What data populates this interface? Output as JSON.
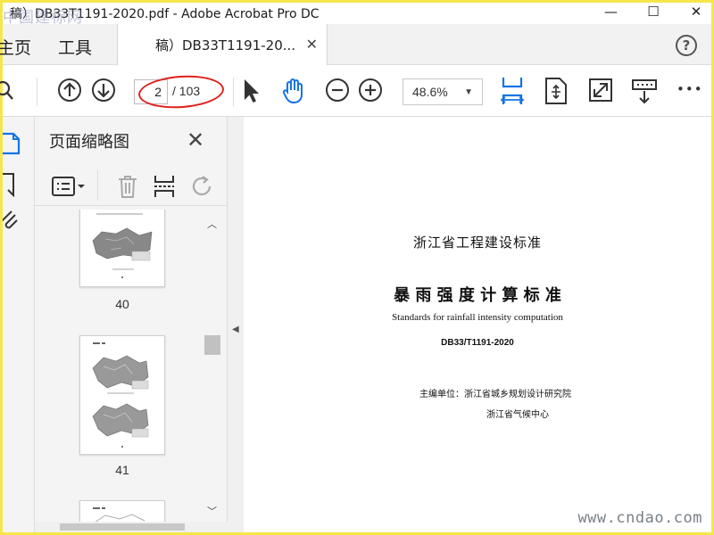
{
  "window": {
    "title": "稿）DB33T1191-2020.pdf - Adobe Acrobat Pro DC",
    "watermark": "中国建标网",
    "controls": [
      "—",
      "☐",
      "✕"
    ]
  },
  "tabs": {
    "home": "主页",
    "tools": "工具",
    "document": "稿）DB33T1191-20...",
    "document_close": "✕",
    "help": "?"
  },
  "toolbar": {
    "page_current": "2",
    "page_total": "/ 103",
    "zoom": "48.6%",
    "zoom_caret": "▼",
    "more": "•••"
  },
  "sidebar": {
    "title": "页面缩略图",
    "close": "✕",
    "thumbnails": [
      {
        "label": "40"
      },
      {
        "label": "41"
      }
    ]
  },
  "document": {
    "org": "浙江省工程建设标准",
    "title_cn": "暴 雨 强 度 计 算 标 准",
    "title_en": "Standards for rainfall intensity computation",
    "code": "DB33/T1191-2020",
    "editor_line1": "主编单位：浙江省城乡规划设计研究院",
    "editor_line2": "浙江省气候中心"
  },
  "footer_watermark": "www.cndao.com",
  "colors": {
    "accent_blue": "#1473e6",
    "annotation_red": "#e0201c",
    "frame_yellow": "#f6e64a"
  }
}
